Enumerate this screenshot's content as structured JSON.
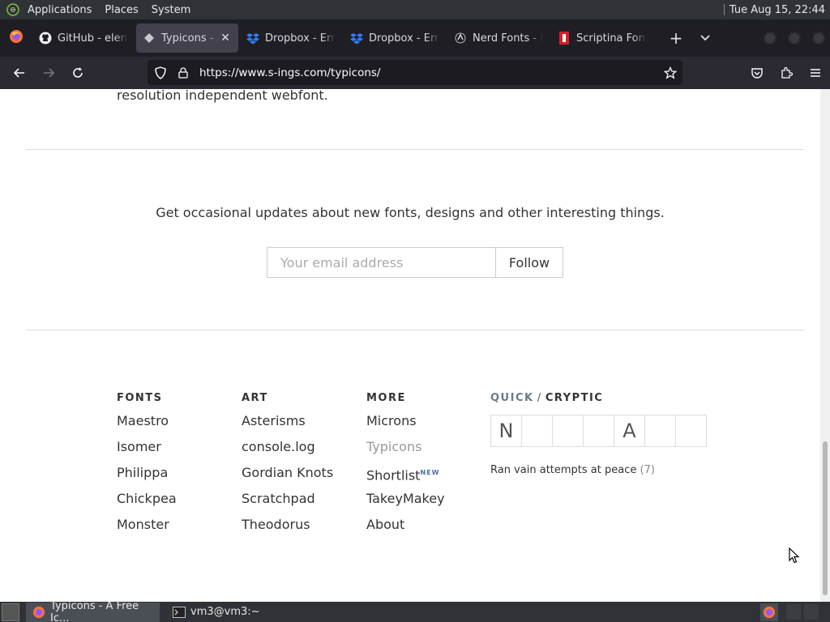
{
  "top_panel": {
    "menus": [
      "Applications",
      "Places",
      "System"
    ],
    "clock": "Tue Aug 15, 22:44"
  },
  "tabs": [
    {
      "label": "GitHub - elena",
      "icon": "github-icon"
    },
    {
      "label": "Typicons - A",
      "icon": "typicons-icon",
      "active": true
    },
    {
      "label": "Dropbox - Erro",
      "icon": "dropbox-icon"
    },
    {
      "label": "Dropbox - Erro",
      "icon": "dropbox-icon"
    },
    {
      "label": "Nerd Fonts - I",
      "icon": "nerdfonts-icon"
    },
    {
      "label": "Scriptina Font",
      "icon": "scriptina-icon"
    }
  ],
  "navbar": {
    "url": "https://www.s-ings.com/typicons/"
  },
  "page": {
    "intro_text": "resolution independent webfont.",
    "newsletter_text": "Get occasional updates about new fonts, designs and other interesting things.",
    "email_placeholder": "Your email address",
    "follow_label": "Follow",
    "columns": [
      {
        "heading": "FONTS",
        "links": [
          "Maestro",
          "Isomer",
          "Philippa",
          "Chickpea",
          "Monster"
        ]
      },
      {
        "heading": "ART",
        "links": [
          "Asterisms",
          "console.log",
          "Gordian Knots",
          "Scratchpad",
          "Theodorus"
        ]
      },
      {
        "heading": "MORE",
        "links": [
          "Microns",
          "Typicons",
          "Shortlist",
          "TakeyMakey",
          "About"
        ],
        "badge": "NEW"
      }
    ],
    "crossword": {
      "title_quick": "QUICK",
      "title_slash": "/",
      "title_cryptic": "CRYPTIC",
      "cells": [
        "N",
        "",
        "",
        "",
        "A",
        "",
        ""
      ],
      "clue": "Ran vain attempts at peace",
      "clue_count": "(7)"
    }
  },
  "taskbar": {
    "items": [
      {
        "label": "Typicons - A Free Ic...",
        "icon": "firefox-icon"
      },
      {
        "label": "vm3@vm3:~",
        "icon": "terminal-icon"
      }
    ]
  },
  "colors": {
    "accent_new_badge": "#4a6fa5",
    "muted_link": "#999999",
    "firefox_orange": "#ff7139"
  }
}
